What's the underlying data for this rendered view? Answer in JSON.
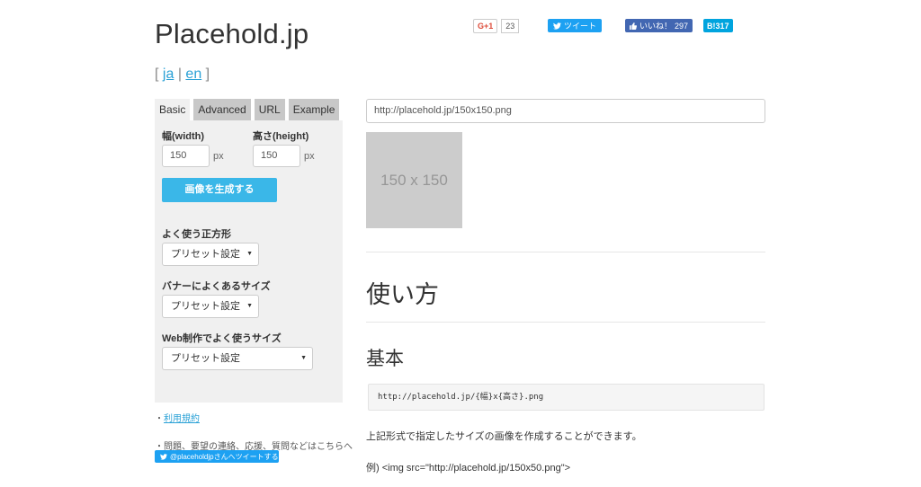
{
  "header": {
    "site_title": "Placehold.jp",
    "lang_open": "[",
    "lang_ja": "ja",
    "lang_sep": "|",
    "lang_en": "en",
    "lang_close": "]"
  },
  "social": {
    "gplus_label": "G+1",
    "gplus_count": "23",
    "tweet_label": "ツイート",
    "like_label": "いいね！",
    "like_count": "297",
    "hatena_label": "B!",
    "hatena_count": "317"
  },
  "tabs": [
    {
      "label": "Basic",
      "active": true
    },
    {
      "label": "Advanced",
      "active": false
    },
    {
      "label": "URL",
      "active": false
    },
    {
      "label": "Example",
      "active": false
    }
  ],
  "form": {
    "width_label": "幅(width)",
    "width_value": "150",
    "width_unit": "px",
    "height_label": "高さ(height)",
    "height_value": "150",
    "height_unit": "px",
    "generate_button": "画像を生成する",
    "square_label": "よく使う正方形",
    "square_select": "プリセット設定",
    "banner_label": "バナーによくあるサイズ",
    "banner_select": "プリセット設定",
    "web_label": "Web制作でよく使うサイズ",
    "web_select": "プリセット設定"
  },
  "footer": {
    "terms_bullet": "・",
    "terms_link": "利用規約",
    "contact_text": "・問題、要望の連絡、応援、質問などはこちらへ",
    "tweet_to": "@placeholdjpさんへツイートする"
  },
  "main": {
    "url_value": "http://placehold.jp/150x150.png",
    "preview_text": "150 x 150",
    "usage_heading": "使い方",
    "basic_heading": "基本",
    "code_sample": "http://placehold.jp/{幅}x{高さ}.png",
    "description": "上記形式で指定したサイズの画像を作成することができます。",
    "example": "例) <img src=\"http://placehold.jp/150x50.png\">"
  },
  "colors": {
    "accent": "#3ab7e8",
    "twitter": "#1da1f2",
    "facebook": "#4267b2",
    "hatena": "#00a4de",
    "placeholder_bg": "#cccccc"
  }
}
